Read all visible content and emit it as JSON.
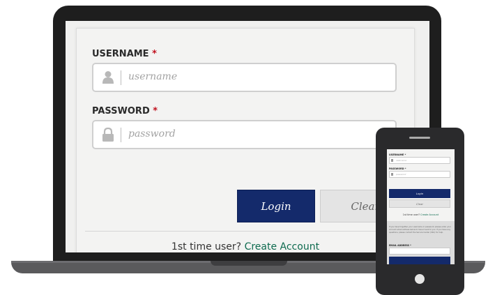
{
  "login_form": {
    "username": {
      "label": "USERNAME",
      "required_mark": "*",
      "placeholder": "username",
      "icon": "user-icon"
    },
    "password": {
      "label": "PASSWORD",
      "required_mark": "*",
      "placeholder": "password",
      "icon": "lock-icon"
    },
    "login_button": "Login",
    "clear_button": "Clear",
    "first_time_text": "1st time user?",
    "create_account_link": "Create Account"
  },
  "colors": {
    "primary_button": "#142a6b",
    "link": "#0e6b4f",
    "required": "#c1121f"
  },
  "mobile": {
    "username_label": "USERNAME *",
    "username_placeholder": "username",
    "password_label": "PASSWORD *",
    "password_placeholder": "password",
    "login_button": "Login",
    "clear_button": "Clear",
    "first_time_text": "1st time user?",
    "create_account_link": "Create Account",
    "info_text": "If you have forgotten your username or password, please enter your account email address below to have it sent to you. If you have any questions, please contact the Service Center (SSC) for help.",
    "email_label": "EMAIL ADDRESS *"
  }
}
